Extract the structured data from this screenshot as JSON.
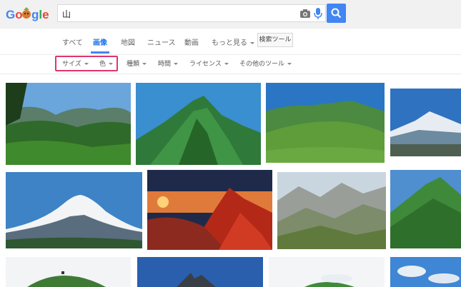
{
  "search": {
    "query": "山"
  },
  "tabs": [
    {
      "label": "すべて",
      "active": false
    },
    {
      "label": "画像",
      "active": true
    },
    {
      "label": "地図",
      "active": false
    },
    {
      "label": "ニュース",
      "active": false
    },
    {
      "label": "動画",
      "active": false
    },
    {
      "label": "もっと見る",
      "active": false,
      "dropdown": true
    }
  ],
  "tools_button": "検索ツール",
  "filters": [
    {
      "label": "サイズ",
      "highlighted": true
    },
    {
      "label": "色",
      "highlighted": true
    },
    {
      "label": "種類",
      "highlighted": false
    },
    {
      "label": "時間",
      "highlighted": false
    },
    {
      "label": "ライセンス",
      "highlighted": false
    },
    {
      "label": "その他のツール",
      "highlighted": false
    }
  ],
  "colors": {
    "accent_blue": "#4285f4",
    "highlight_border": "#e0336e",
    "topbar_bg": "#f1f1f1"
  },
  "icons": [
    "doodle-logo",
    "camera-icon",
    "microphone-icon",
    "search-icon",
    "chevron-down-icon"
  ],
  "image_results": [
    {
      "name": "mountain-range-forest"
    },
    {
      "name": "green-peak-blue-sky"
    },
    {
      "name": "grassy-ridge"
    },
    {
      "name": "snowy-volcano-small"
    },
    {
      "name": "snowcapped-volcano"
    },
    {
      "name": "red-autumn-peak-sunset"
    },
    {
      "name": "rocky-valley"
    },
    {
      "name": "green-cone-peak"
    },
    {
      "name": "green-hill"
    },
    {
      "name": "dark-peak-blue-sky"
    },
    {
      "name": "green-hill-clouds"
    },
    {
      "name": "blue-sky-clouds"
    }
  ]
}
